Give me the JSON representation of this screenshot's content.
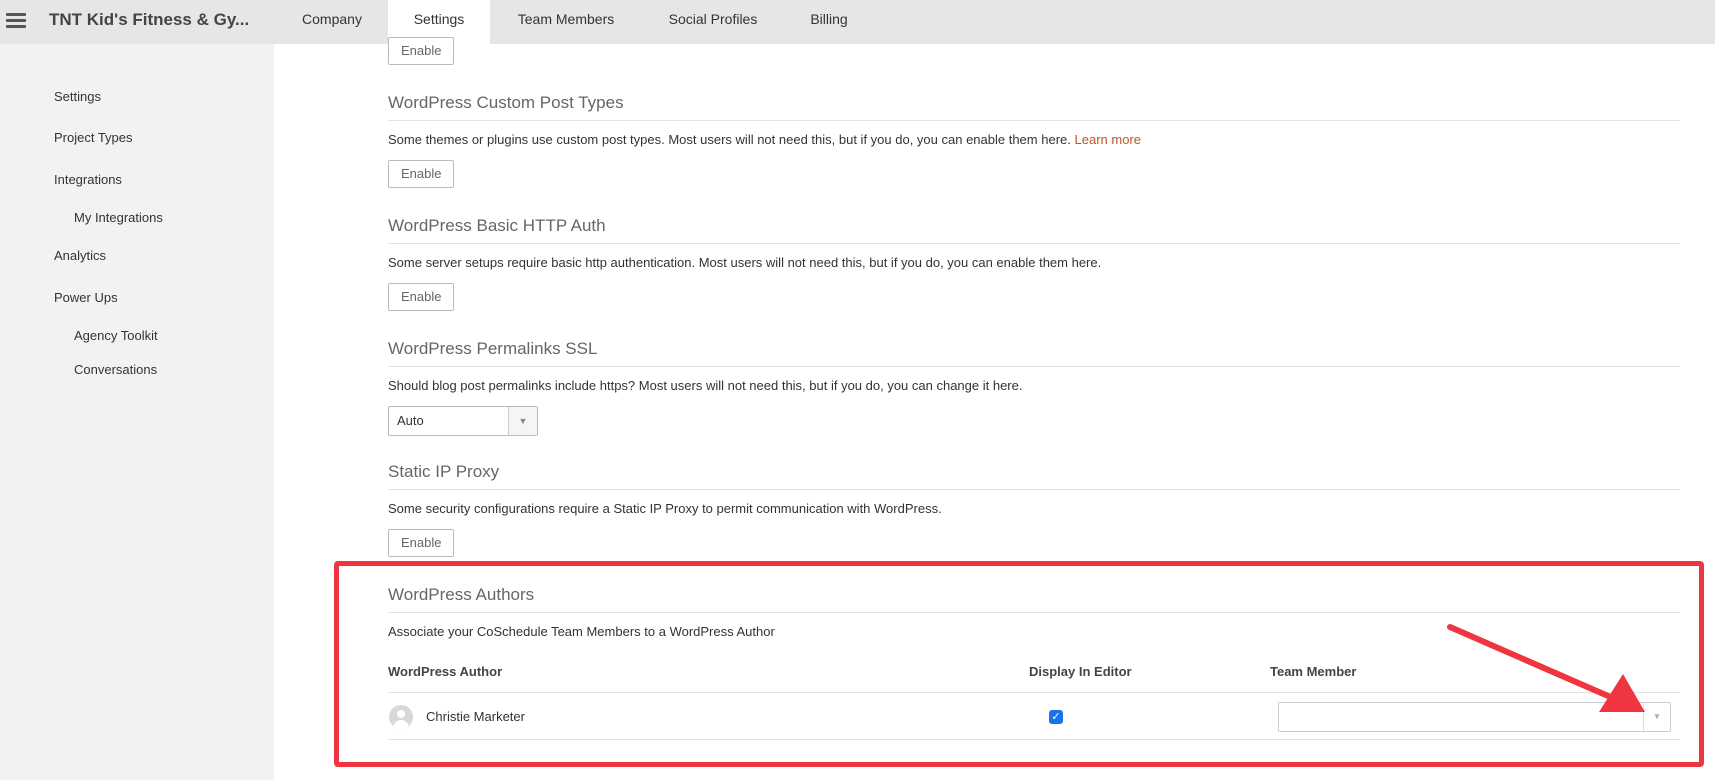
{
  "header": {
    "app_title": "TNT Kid's Fitness & Gy...",
    "tabs": [
      "Company",
      "Settings",
      "Team Members",
      "Social Profiles",
      "Billing"
    ],
    "active_tab": "Settings"
  },
  "sidebar": {
    "items": [
      "Settings",
      "Project Types",
      "Integrations",
      "My Integrations",
      "Analytics",
      "Power Ups",
      "Agency Toolkit",
      "Conversations"
    ]
  },
  "sections": {
    "top_enable_label": "Enable",
    "custom_post_types": {
      "title": "WordPress Custom Post Types",
      "description": "Some themes or plugins use custom post types. Most users will not need this, but if you do, you can enable them here.",
      "link": "Learn more",
      "button": "Enable"
    },
    "basic_http_auth": {
      "title": "WordPress Basic HTTP Auth",
      "description": "Some server setups require basic http authentication. Most users will not need this, but if you do, you can enable them here.",
      "button": "Enable"
    },
    "permalinks_ssl": {
      "title": "WordPress Permalinks SSL",
      "description": "Should blog post permalinks include https? Most users will not need this, but if you do, you can change it here.",
      "select_value": "Auto"
    },
    "static_ip_proxy": {
      "title": "Static IP Proxy",
      "description": "Some security configurations require a Static IP Proxy to permit communication with WordPress.",
      "button": "Enable"
    },
    "wp_authors": {
      "title": "WordPress Authors",
      "description": "Associate your CoSchedule Team Members to a WordPress Author",
      "columns": [
        "WordPress Author",
        "Display In Editor",
        "Team Member"
      ],
      "rows": [
        {
          "author": "Christie Marketer",
          "display_in_editor": true,
          "team_member": ""
        }
      ]
    }
  },
  "colors": {
    "highlight": "#ee3540",
    "link": "#c0522e",
    "checkbox": "#1a73e8"
  }
}
